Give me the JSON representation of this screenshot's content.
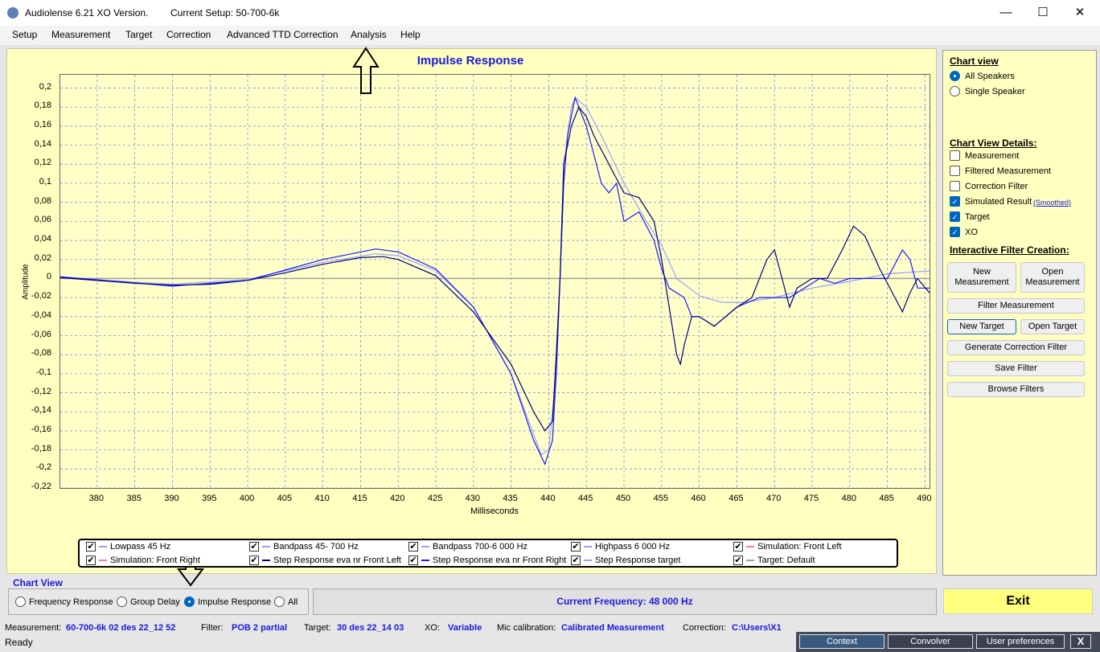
{
  "window": {
    "app_title": "Audiolense 6.21 XO Version.",
    "setup": "Current Setup: 50-700-6k",
    "minimize": "—",
    "maximize": "☐",
    "close": "✕"
  },
  "menu": [
    "Setup",
    "Measurement",
    "Target",
    "Correction",
    "Advanced TTD Correction",
    "Analysis",
    "Help"
  ],
  "legend": [
    {
      "label": "Lowpass  45 Hz",
      "color": "#9aa0ff"
    },
    {
      "label": "Bandpass   45- 700 Hz",
      "color": "#9aa0ff"
    },
    {
      "label": "Bandpass   700-6 000 Hz",
      "color": "#9aa0ff"
    },
    {
      "label": "Highpass  6 000 Hz",
      "color": "#9aa0ff"
    },
    {
      "label": "Simulation: Front Left",
      "color": "#ff8080"
    },
    {
      "label": "Simulation: Front Right",
      "color": "#ff8080"
    },
    {
      "label": "Step Response eva nr Front Left",
      "color": "#000080"
    },
    {
      "label": "Step Response eva nr Front Right",
      "color": "#1a1aff"
    },
    {
      "label": "Step Response target",
      "color": "#9aa0ff"
    },
    {
      "label": "Target: Default",
      "color": "#a0a0a0"
    }
  ],
  "right_panel": {
    "chart_view_heading": "Chart view",
    "view_options": [
      {
        "label": "All Speakers",
        "selected": true
      },
      {
        "label": "Single Speaker",
        "selected": false
      }
    ],
    "details_heading": "Chart View Details:",
    "details": [
      {
        "label": "Measurement",
        "checked": false
      },
      {
        "label": "Filtered Measurement",
        "checked": false
      },
      {
        "label": "Correction Filter",
        "checked": false
      },
      {
        "label": "Simulated Result",
        "checked": true
      },
      {
        "label": "Target",
        "checked": true
      },
      {
        "label": "XO",
        "checked": true
      }
    ],
    "smoothed_link": "(Smoothed)",
    "ifc_heading": "Interactive Filter Creation:",
    "buttons": {
      "new_measurement": "New Measurement",
      "open_measurement": "Open Measurement",
      "filter_measurement": "Filter Measurement",
      "new_target": "New Target",
      "open_target": "Open Target",
      "generate": "Generate Correction Filter",
      "save": "Save Filter",
      "browse": "Browse Filters"
    }
  },
  "bottom": {
    "chart_view_label": "Chart View",
    "modes": [
      {
        "label": "Frequency Response",
        "selected": false
      },
      {
        "label": "Group Delay",
        "selected": false
      },
      {
        "label": "Impulse Response",
        "selected": true
      },
      {
        "label": "All",
        "selected": false
      }
    ],
    "current_frequency": "Current Frequency: 48 000 Hz",
    "exit": "Exit"
  },
  "status": {
    "measurement_label": "Measurement:",
    "measurement": "60-700-6k 02 des 22_12 52",
    "filter_label": "Filter:",
    "filter": "POB 2 partial",
    "target_label": "Target:",
    "target": "30 des 22_14 03",
    "xo_label": "XO:",
    "xo": "Variable",
    "mic_label": "Mic calibration:",
    "mic": "Calibrated Measurement",
    "correction_label": "Correction:",
    "correction": "C:\\Users\\X1",
    "ready": "Ready"
  },
  "taskbar": {
    "context": "Context",
    "convolver": "Convolver",
    "user_prefs": "User preferences",
    "close": "X"
  },
  "chart_data": {
    "type": "line",
    "title": "Impulse Response",
    "xlabel": "Milliseconds",
    "ylabel": "Amplitude",
    "xlim": [
      375.1,
      490.6
    ],
    "ylim": [
      -0.22,
      0.214
    ],
    "xticks": [
      380,
      385,
      390,
      395,
      400,
      405,
      410,
      415,
      420,
      425,
      430,
      435,
      440,
      445,
      450,
      455,
      460,
      465,
      470,
      475,
      480,
      485,
      490
    ],
    "yticks": [
      "0,2",
      "0,18",
      "0,16",
      "0,14",
      "0,12",
      "0,1",
      "0,08",
      "0,06",
      "0,04",
      "0,02",
      "0",
      "-0,02",
      "-0,04",
      "-0,06",
      "-0,08",
      "-0,1",
      "-0,12",
      "-0,14",
      "-0,16",
      "-0,18",
      "-0,2",
      "-0,22"
    ],
    "ytick_values": [
      0.2,
      0.18,
      0.16,
      0.14,
      0.12,
      0.1,
      0.08,
      0.06,
      0.04,
      0.02,
      0,
      -0.02,
      -0.04,
      -0.06,
      -0.08,
      -0.1,
      -0.12,
      -0.14,
      -0.16,
      -0.18,
      -0.2,
      -0.22
    ],
    "grid": true,
    "series": [
      {
        "name": "Target: Default",
        "color": "#a0a0a0",
        "x": [
          375,
          490.6
        ],
        "y": [
          0,
          0
        ]
      },
      {
        "name": "Step Response target",
        "color": "#9aa0ff",
        "x": [
          375,
          390,
          400,
          410,
          417,
          420,
          425,
          430,
          435,
          439,
          440,
          441,
          441.5,
          442,
          443,
          443.5,
          445,
          447,
          450,
          453,
          455,
          457,
          460,
          463,
          466,
          470,
          475,
          480,
          485,
          490.6
        ],
        "y": [
          0.001,
          -0.006,
          -0.001,
          0.017,
          0.026,
          0.024,
          0.008,
          -0.03,
          -0.1,
          -0.185,
          -0.18,
          -0.1,
          0,
          0.12,
          0.18,
          0.19,
          0.18,
          0.15,
          0.1,
          0.06,
          0.035,
          0,
          -0.018,
          -0.025,
          -0.025,
          -0.02,
          -0.01,
          -0.003,
          0.005,
          0.008
        ]
      },
      {
        "name": "Step Response eva nr Front Right",
        "color": "#1a1aff",
        "x": [
          375,
          390,
          400,
          410,
          417,
          420,
          425,
          430,
          435,
          438,
          439.5,
          440.5,
          441,
          441.5,
          442,
          442.5,
          443.5,
          444.5,
          445,
          446,
          447,
          448,
          449,
          450,
          452,
          454,
          455,
          456,
          458,
          459,
          460,
          462,
          465,
          468,
          470,
          472,
          474,
          476,
          478,
          480,
          482,
          485,
          487,
          488,
          489,
          490.6
        ],
        "y": [
          0.002,
          -0.008,
          -0.002,
          0.02,
          0.031,
          0.028,
          0.01,
          -0.03,
          -0.1,
          -0.17,
          -0.195,
          -0.17,
          -0.1,
          0,
          0.1,
          0.15,
          0.19,
          0.17,
          0.16,
          0.13,
          0.1,
          0.09,
          0.1,
          0.06,
          0.07,
          0.04,
          0.01,
          -0.01,
          -0.02,
          -0.04,
          -0.04,
          -0.05,
          -0.03,
          -0.02,
          -0.02,
          -0.02,
          -0.01,
          0,
          -0.005,
          0,
          0,
          0,
          0.03,
          0.02,
          -0.01,
          -0.01
        ]
      },
      {
        "name": "Step Response eva nr Front Left",
        "color": "#000080",
        "x": [
          375,
          385,
          390,
          395,
          400,
          405,
          410,
          415,
          418,
          420,
          425,
          430,
          435,
          438,
          439.5,
          440.5,
          441,
          441.5,
          442,
          443,
          444,
          445,
          446,
          448,
          450,
          452,
          454,
          455,
          456,
          457,
          457.5,
          458,
          459,
          460,
          462,
          465,
          467,
          469,
          470,
          471,
          472,
          473,
          475,
          477,
          479,
          480.5,
          482,
          484,
          486,
          487,
          488,
          489,
          490.6
        ],
        "y": [
          0.001,
          -0.005,
          -0.007,
          -0.006,
          -0.002,
          0.006,
          0.015,
          0.022,
          0.023,
          0.02,
          0.003,
          -0.035,
          -0.09,
          -0.14,
          -0.16,
          -0.15,
          -0.08,
          0,
          0.12,
          0.16,
          0.18,
          0.17,
          0.15,
          0.12,
          0.09,
          0.085,
          0.06,
          0.02,
          -0.03,
          -0.08,
          -0.09,
          -0.07,
          -0.04,
          -0.04,
          -0.05,
          -0.03,
          -0.02,
          0.02,
          0.03,
          0,
          -0.03,
          -0.01,
          0,
          0,
          0.03,
          0.055,
          0.045,
          0.01,
          -0.02,
          -0.035,
          -0.015,
          0,
          -0.015
        ]
      }
    ]
  }
}
